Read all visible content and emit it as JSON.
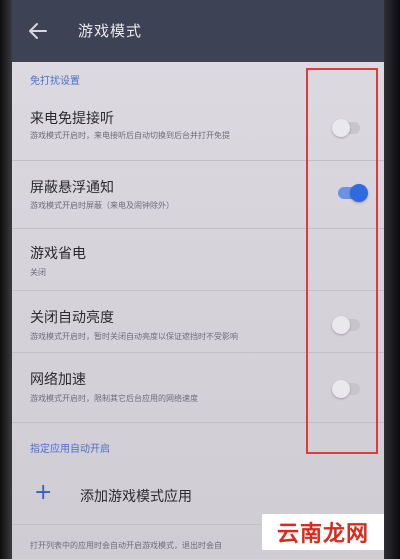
{
  "appbar": {
    "title": "游戏模式",
    "back_icon": "arrow-left-icon"
  },
  "sections": {
    "no_disturb_header": "免打扰设置",
    "auto_launch_header": "指定应用自动开启"
  },
  "settings": [
    {
      "title": "来电免提接听",
      "desc": "游戏模式开启时，来电接听后自动切换到后台并打开免提",
      "toggle": "off"
    },
    {
      "title": "屏蔽悬浮通知",
      "desc": "游戏模式开启时屏蔽（来电及闹钟除外）",
      "toggle": "on"
    },
    {
      "title": "游戏省电",
      "desc": "关闭",
      "toggle": null
    },
    {
      "title": "关闭自动亮度",
      "desc": "游戏模式开启时，暂时关闭自动亮度以保证遮挡时不受影响",
      "toggle": "off"
    },
    {
      "title": "网络加速",
      "desc": "游戏模式开启时，限制其它后台应用的网络速度",
      "toggle": "off"
    }
  ],
  "add_app": {
    "icon": "plus-icon",
    "label": "添加游戏模式应用"
  },
  "footer_text": "打开列表中的应用时会自动开启游戏模式，退出时会自",
  "watermark": "云南龙网",
  "colors": {
    "appbar": "#3d4255",
    "accent": "#2f6ae0",
    "highlight": "#e53935",
    "watermark": "#d92a1f"
  }
}
